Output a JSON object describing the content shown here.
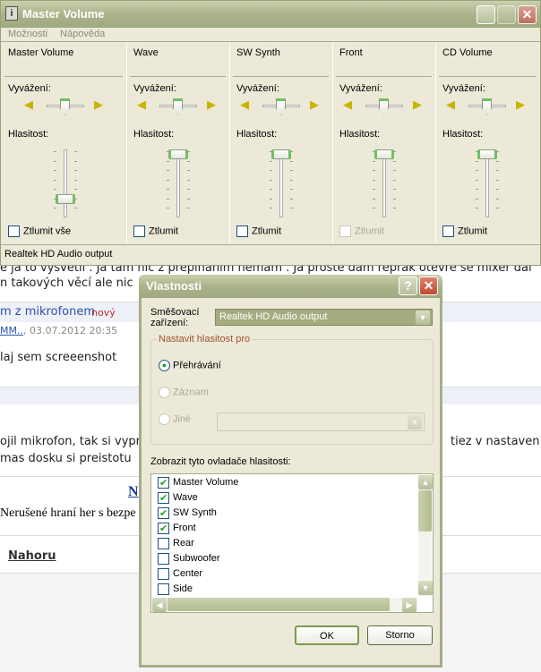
{
  "web": {
    "line1": "e já to vysvětlí . Já tam nic z přepínáním nemám . Já prostě dám reprák otevře se mixér dal",
    "line2": "n takových věcí ale nic",
    "post_title": "m z mikrofonem",
    "post_badge": "nový",
    "post_author": "MM..",
    "post_date": ", 03.07.2012 20:35",
    "post_text": "laj sem screeenshot",
    "reply1": "ojil mikrofon, tak si vypr",
    "reply1_end": "tiez v nastaven",
    "reply2": " mas dosku si preistotu",
    "ad_link": "N",
    "ad_text": "Nerušené hraní her s bezpe",
    "top_link": "Nahoru"
  },
  "mixer": {
    "title": "Master Volume",
    "menu": [
      "Možnosti",
      "Nápověda"
    ],
    "balance_label": "Vyvážení:",
    "volume_label": "Hlasitost:",
    "channels": [
      {
        "name": "Master Volume",
        "mute": "Ztlumit vše",
        "volume": 0.25,
        "balance": 0.5,
        "muted": false,
        "disabled": false
      },
      {
        "name": "Wave",
        "mute": "Ztlumit",
        "volume": 1.0,
        "balance": 0.5,
        "muted": false,
        "disabled": false
      },
      {
        "name": "SW Synth",
        "mute": "Ztlumit",
        "volume": 1.0,
        "balance": 0.5,
        "muted": false,
        "disabled": false
      },
      {
        "name": "Front",
        "mute": "Ztlumit",
        "volume": 1.0,
        "balance": 0.5,
        "muted": false,
        "disabled": true
      },
      {
        "name": "CD Volume",
        "mute": "Ztlumit",
        "volume": 1.0,
        "balance": 0.5,
        "muted": false,
        "disabled": false
      }
    ],
    "status": "Realtek HD Audio output"
  },
  "dialog": {
    "title": "Vlastnosti",
    "device_label_1": "Směšovací",
    "device_label_2": "zařízení:",
    "device_value": "Realtek HD Audio output",
    "group_label": "Nastavit hlasitost pro",
    "radios": [
      {
        "label": "Přehrávání",
        "checked": true,
        "disabled": false
      },
      {
        "label": "Záznam",
        "checked": false,
        "disabled": true
      },
      {
        "label": "Jiné",
        "checked": false,
        "disabled": true
      }
    ],
    "list_label": "Zobrazit tyto ovladače hlasitosti:",
    "items": [
      {
        "label": "Master Volume",
        "checked": true
      },
      {
        "label": "Wave",
        "checked": true
      },
      {
        "label": "SW Synth",
        "checked": true
      },
      {
        "label": "Front",
        "checked": true
      },
      {
        "label": "Rear",
        "checked": false
      },
      {
        "label": "Subwoofer",
        "checked": false
      },
      {
        "label": "Center",
        "checked": false
      },
      {
        "label": "Side",
        "checked": false
      }
    ],
    "ok": "OK",
    "cancel": "Storno"
  }
}
